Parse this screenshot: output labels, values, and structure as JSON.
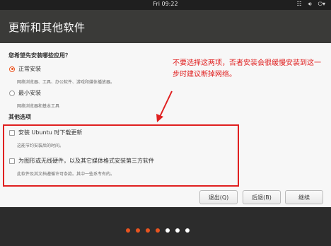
{
  "topbar": {
    "clock": "Fri 09:22",
    "icons": [
      "network-icon",
      "volume-icon",
      "power-icon"
    ]
  },
  "header": {
    "title": "更新和其他软件"
  },
  "question": "您希望先安装哪些应用？",
  "options": [
    {
      "label": "正常安装",
      "desc": "网络浏览器、工具、办公软件、游戏和媒体播放器。",
      "selected": true
    },
    {
      "label": "最小安装",
      "desc": "网络浏览器和基本工具",
      "selected": false
    }
  ],
  "other_section": "其他选项",
  "checks": [
    {
      "label": "安装 Ubuntu 时下载更新",
      "desc": "这能节约安装后的时间。",
      "checked": false
    },
    {
      "label": "为图形或无线硬件，以及其它媒体格式安装第三方软件",
      "desc": "此软件及其文档遵循许可条款。其中一些系专有的。",
      "checked": false
    }
  ],
  "annotation": "不要选择这两项，否者安装会很缓慢安装到这一步时建议断掉网络。",
  "buttons": {
    "quit": "退出(Q)",
    "back": "后退(B)",
    "continue": "继续"
  },
  "progress": {
    "total_steps": 7,
    "completed_steps": 4
  },
  "colors": {
    "accent": "#e95420",
    "annotation": "#e02020",
    "header_bg": "#3a3a38"
  }
}
